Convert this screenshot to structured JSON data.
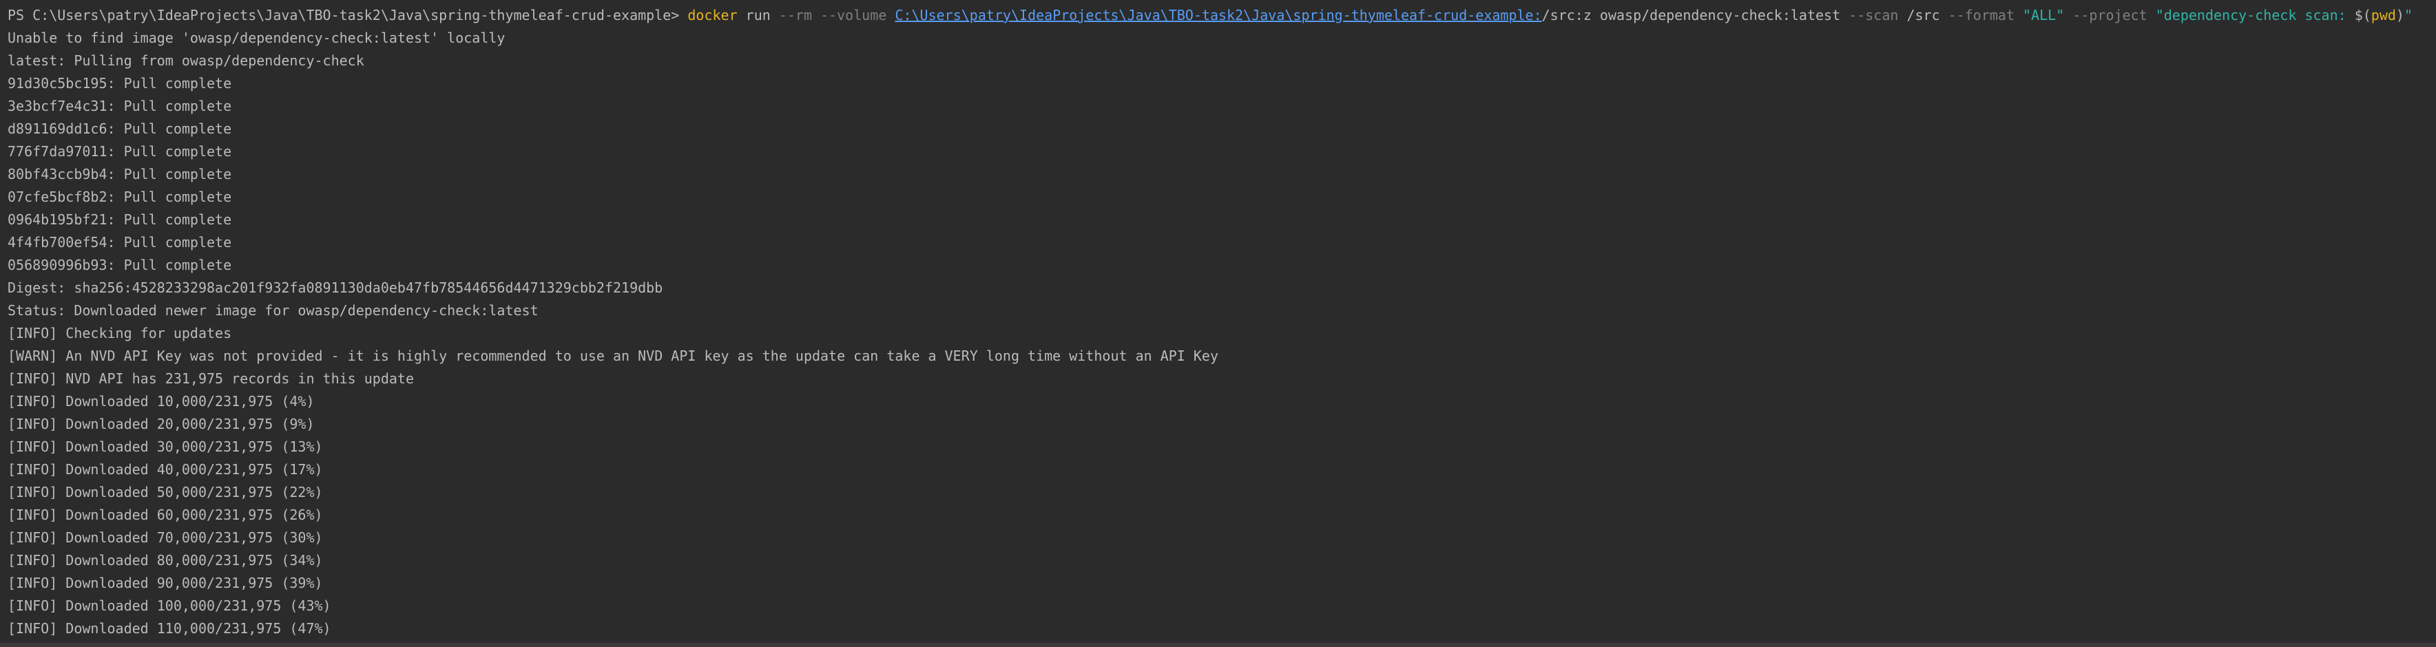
{
  "colors": {
    "background": "#2b2b2b",
    "text": "#bbbbbb",
    "command": "#e6b422",
    "flag": "#7f7f7f",
    "path_link": "#589df6",
    "string": "#2fb5a8"
  },
  "command_line": {
    "prompt": "PS C:\\Users\\patry\\IdeaProjects\\Java\\TBO-task2\\Java\\spring-thymeleaf-crud-example> ",
    "cmd": "docker",
    "run": " run ",
    "rm_flag": "--rm",
    "volume_flag": " --volume ",
    "volume_path": "C:\\Users\\patry\\IdeaProjects\\Java\\TBO-task2\\Java\\spring-thymeleaf-crud-example:",
    "volume_target": "/src:z owasp/dependency-check:latest ",
    "scan_flag": "--scan",
    "scan_value": " /src ",
    "format_flag": "--format",
    "format_value": " \"ALL\" ",
    "project_flag": "--project",
    "project_value_start": " \"dependency-check scan: ",
    "pwd_open": "$(",
    "pwd_word": "pwd",
    "pwd_close": ")",
    "project_value_end": "\""
  },
  "output_lines": [
    "Unable to find image 'owasp/dependency-check:latest' locally",
    "latest: Pulling from owasp/dependency-check",
    "91d30c5bc195: Pull complete",
    "3e3bcf7e4c31: Pull complete",
    "d891169dd1c6: Pull complete",
    "776f7da97011: Pull complete",
    "80bf43ccb9b4: Pull complete",
    "07cfe5bcf8b2: Pull complete",
    "0964b195bf21: Pull complete",
    "4f4fb700ef54: Pull complete",
    "056890996b93: Pull complete",
    "Digest: sha256:4528233298ac201f932fa0891130da0eb47fb78544656d4471329cbb2f219dbb",
    "Status: Downloaded newer image for owasp/dependency-check:latest",
    "[INFO] Checking for updates",
    "[WARN] An NVD API Key was not provided - it is highly recommended to use an NVD API key as the update can take a VERY long time without an API Key",
    "[INFO] NVD API has 231,975 records in this update",
    "[INFO] Downloaded 10,000/231,975 (4%)",
    "[INFO] Downloaded 20,000/231,975 (9%)",
    "[INFO] Downloaded 30,000/231,975 (13%)",
    "[INFO] Downloaded 40,000/231,975 (17%)",
    "[INFO] Downloaded 50,000/231,975 (22%)",
    "[INFO] Downloaded 60,000/231,975 (26%)",
    "[INFO] Downloaded 70,000/231,975 (30%)",
    "[INFO] Downloaded 80,000/231,975 (34%)",
    "[INFO] Downloaded 90,000/231,975 (39%)",
    "[INFO] Downloaded 100,000/231,975 (43%)",
    "[INFO] Downloaded 110,000/231,975 (47%)"
  ]
}
